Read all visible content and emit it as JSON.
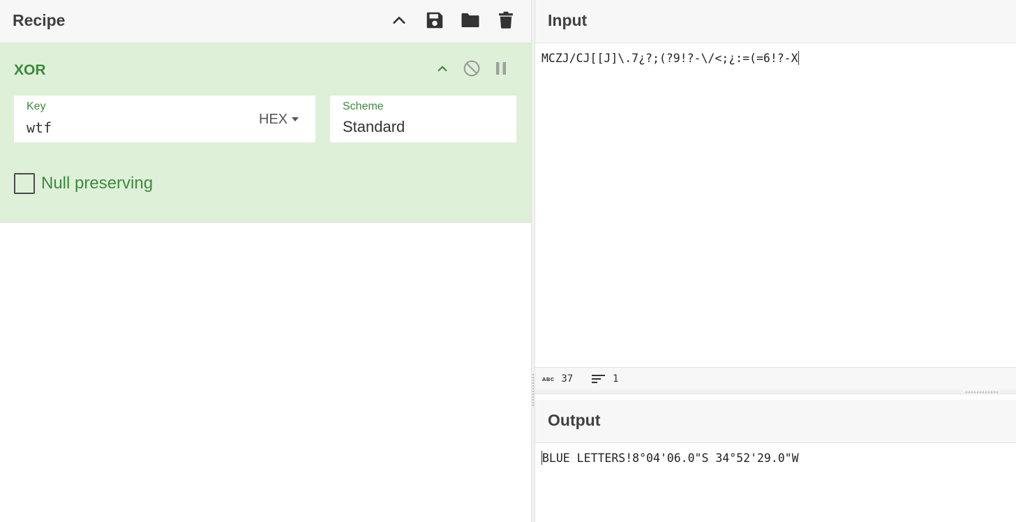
{
  "recipe": {
    "title": "Recipe",
    "icons": {
      "collapse": "chevron-up-icon",
      "save": "save-icon",
      "load": "folder-icon",
      "clear": "trash-icon"
    }
  },
  "operation": {
    "name": "XOR",
    "controls": {
      "collapse": "chevron-up-icon",
      "disable": "disable-icon",
      "breakpoint": "pause-icon"
    },
    "key": {
      "label": "Key",
      "value": "wtf",
      "format": "HEX"
    },
    "scheme": {
      "label": "Scheme",
      "value": "Standard"
    },
    "null_preserving": {
      "label": "Null preserving",
      "checked": false
    },
    "accent_color": "#3c8a3c",
    "background_color": "#dff0d8"
  },
  "input": {
    "title": "Input",
    "text": "MCZJ/CJ[[J]\\.7¿?;(?9!?-\\/<;¿:=(=6!?-X",
    "char_count": "37",
    "line_count": "1"
  },
  "output": {
    "title": "Output",
    "text": "BLUE LETTERS!8°04'06.0\"S 34°52'29.0\"W"
  }
}
